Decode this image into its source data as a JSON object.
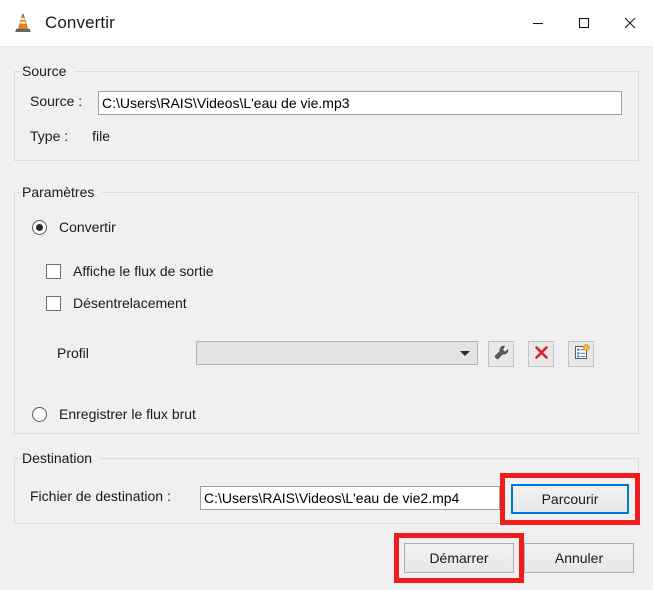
{
  "window": {
    "title": "Convertir",
    "icon": "vlc-cone-icon",
    "controls": {
      "minimize": "—",
      "maximize": "□",
      "close": "✕"
    }
  },
  "source_group": {
    "legend": "Source",
    "source_label": "Source :",
    "source_value": "C:\\Users\\RAIS\\Videos\\L'eau de vie.mp3",
    "type_label": "Type :",
    "type_value": "file"
  },
  "settings_group": {
    "legend": "Paramètres",
    "convert_radio": {
      "label": "Convertir",
      "checked": true
    },
    "checkboxes": [
      {
        "label": "Affiche le flux de sortie",
        "checked": false
      },
      {
        "label": "Désentrelacement",
        "checked": false
      }
    ],
    "profile_label": "Profil",
    "profile_value": "",
    "profile_buttons": [
      {
        "name": "edit-profile-button",
        "icon": "wrench-icon"
      },
      {
        "name": "delete-profile-button",
        "icon": "red-x-icon"
      },
      {
        "name": "new-profile-button",
        "icon": "new-profile-icon"
      }
    ],
    "raw_radio": {
      "label": "Enregistrer le flux brut",
      "checked": false
    }
  },
  "destination_group": {
    "legend": "Destination",
    "file_label": "Fichier de destination :",
    "file_value": "C:\\Users\\RAIS\\Videos\\L'eau de vie2.mp4",
    "browse_label": "Parcourir"
  },
  "footer": {
    "start_label": "Démarrer",
    "cancel_label": "Annuler"
  },
  "annotations": {
    "highlight_color": "#ee1c1c",
    "highlighted": [
      "Parcourir",
      "Démarrer"
    ]
  },
  "colors": {
    "dialog_background": "#f0f0f0",
    "titlebar_background": "#ffffff",
    "field_background": "#ffffff",
    "accent_focus": "#0078d7",
    "annotation_red": "#ee1c1c",
    "vlc_orange": "#e8851a"
  }
}
